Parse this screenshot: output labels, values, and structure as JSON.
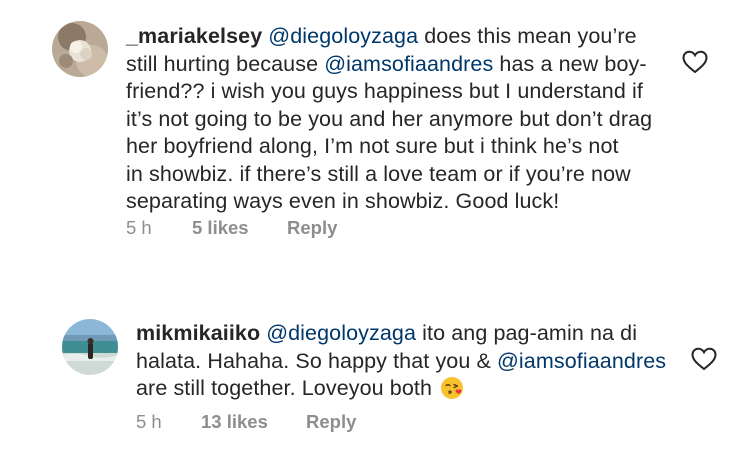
{
  "comments": [
    {
      "username": "_mariakelsey",
      "mention1": "@diegoloyzaga",
      "line1_rest": " does this mean you’re",
      "line2_pre": "still hurting because ",
      "mention2": "@iamsofiaandres",
      "line2_post": " has a new boy-",
      "line3": "friend?? i wish you guys happiness but I understand if",
      "line4": "it’s not going to be you and her anymore but don’t drag",
      "line5": "her boyfriend along, I’m not sure but i think he’s not",
      "line6": "in showbiz. if there’s still a love team or if you’re now",
      "line7": "separating ways even in showbiz. Good luck!",
      "time": "5 h",
      "likes": "5 likes",
      "reply": "Reply",
      "avatar_icon": "flower-photo",
      "like_icon": "heart-outline-icon"
    },
    {
      "username": "mikmikaiiko",
      "mention1": "@diegoloyzaga",
      "line1_rest": " ito ang pag-amin na di",
      "line2": "halata. Hahaha. So happy that you & ",
      "mention2": "@iamsofiaandres",
      "line3": "are still together. Loveyou both",
      "emoji": "face-blowing-kiss",
      "time": "5 h",
      "likes": "13 likes",
      "reply": "Reply",
      "avatar_icon": "beach-photo",
      "like_icon": "heart-outline-icon"
    }
  ],
  "colors": {
    "text": "#262626",
    "mention": "#00376b",
    "meta": "#8e8e8e"
  }
}
